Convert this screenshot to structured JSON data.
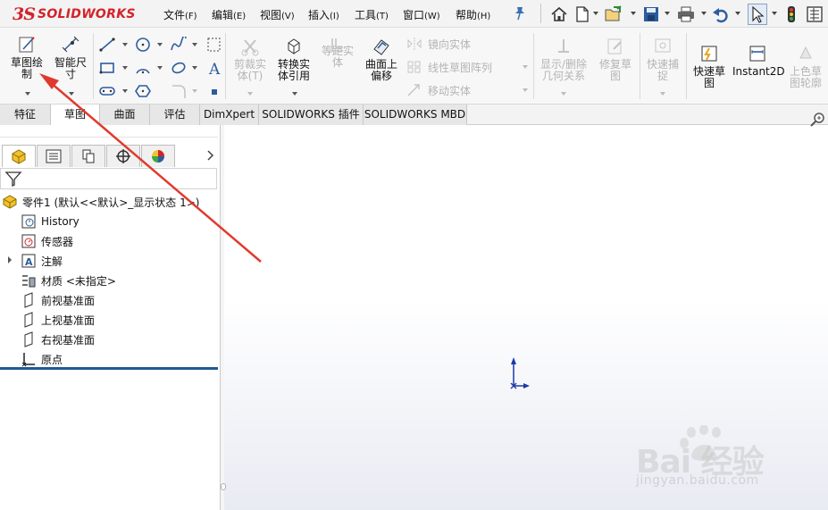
{
  "app": {
    "logo_ds": "3S",
    "logo_name": "SOLIDWORKS",
    "brand_color": "#d2232a"
  },
  "menu": [
    {
      "label": "文件",
      "acc": "(F)"
    },
    {
      "label": "编辑",
      "acc": "(E)"
    },
    {
      "label": "视图",
      "acc": "(V)"
    },
    {
      "label": "插入",
      "acc": "(I)"
    },
    {
      "label": "工具",
      "acc": "(T)"
    },
    {
      "label": "窗口",
      "acc": "(W)"
    },
    {
      "label": "帮助",
      "acc": "(H)"
    }
  ],
  "quick_access": [
    "home-icon",
    "new-document-icon",
    "open-icon",
    "save-icon",
    "print-icon",
    "undo-icon",
    "select-icon",
    "traffic-light-icon",
    "options-icon"
  ],
  "ribbon": {
    "sketch": "草图绘\n制",
    "smart_dimension": "智能尺\n寸",
    "trim_entities": "剪裁实\n体(T)",
    "convert_entities": "转换实\n体引用",
    "offset_entities": "等距实\n体",
    "offset_on_surface": "曲面上\n偏移",
    "mirror_entities": "镜向实体",
    "linear_pattern": "线性草图阵列",
    "move_entities": "移动实体",
    "display_relations": "显示/删除\n几何关系",
    "repair_sketch": "修复草\n图",
    "quick_snaps": "快速捕\n捉",
    "rapid_sketch": "快速草\n图",
    "instant2d": "Instant2D",
    "shaded_contours": "上色草\n图轮廓"
  },
  "tabs": [
    "特征",
    "草图",
    "曲面",
    "评估",
    "DimXpert",
    "SOLIDWORKS 插件",
    "SOLIDWORKS MBD"
  ],
  "active_tab": "草图",
  "feature_tree": {
    "part": "零件1  (默认<<默认>_显示状态 1>)",
    "items": [
      {
        "label": "History",
        "icon": "history-icon"
      },
      {
        "label": "传感器",
        "icon": "sensor-icon"
      },
      {
        "label": "注解",
        "icon": "annotations-icon",
        "expandable": true
      },
      {
        "label": "材质 <未指定>",
        "icon": "material-icon"
      },
      {
        "label": "前视基准面",
        "icon": "plane-icon"
      },
      {
        "label": "上视基准面",
        "icon": "plane-icon"
      },
      {
        "label": "右视基准面",
        "icon": "plane-icon"
      },
      {
        "label": "原点",
        "icon": "origin-icon"
      }
    ]
  },
  "watermark": {
    "text": "Bai 经验",
    "sub": "jingyan.baidu.com"
  },
  "colors": {
    "arrow": "#e03a2e",
    "accent_blue": "#1f5a93"
  }
}
